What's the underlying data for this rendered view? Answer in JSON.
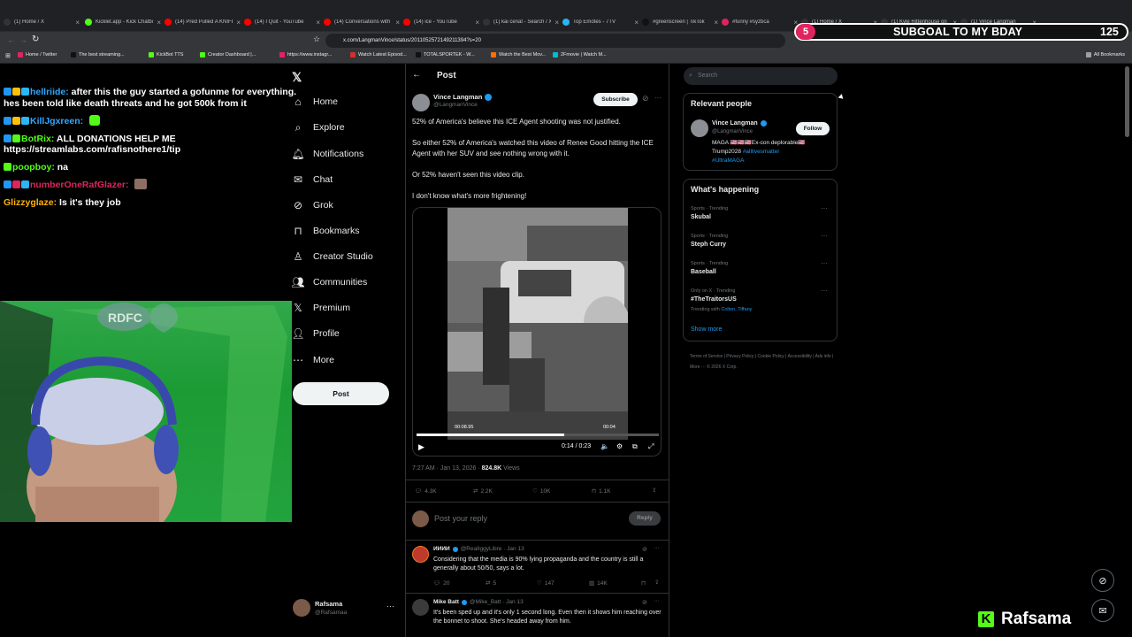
{
  "browser": {
    "tabs": [
      {
        "label": "(1) Home / X",
        "color": "#333"
      },
      {
        "label": "Kicklet.app - Kick Chatbot",
        "color": "#53fc18"
      },
      {
        "label": "(14) Pred Pulled A KNIFE",
        "color": "#ff0000"
      },
      {
        "label": "(14) I Quit - YouTube",
        "color": "#ff0000"
      },
      {
        "label": "(14) Conversations with",
        "color": "#ff0000"
      },
      {
        "label": "(14) ice - YouTube",
        "color": "#ff0000"
      },
      {
        "label": "(1) kai cenat - Search / X",
        "color": "#333"
      },
      {
        "label": "Top Emotes - 7TV",
        "color": "#29b6f6"
      },
      {
        "label": "#greenscreen | TikTok",
        "color": "#111"
      },
      {
        "label": "#funny #syzbca",
        "color": "#e0245e"
      },
      {
        "label": "(1) Home / X",
        "color": "#333"
      },
      {
        "label": "(1) Kyle Rittenhouse on",
        "color": "#333"
      },
      {
        "label": "(1) Vince Langman",
        "color": "#333"
      }
    ],
    "url": "x.com/LangmanVince/status/2011052572149211394?s=20",
    "bookmarks": [
      "Home / Twitter",
      "The best streaming...",
      "KickBot TTS",
      "Creator Dashboard |...",
      "https://www.instagr...",
      "Watch Latest Episod...",
      "TOTALSPORTEK - W...",
      "Watch the Best Mov...",
      "2Fmovie | Watch M..."
    ],
    "all_bookmarks": "All Bookmarks"
  },
  "overlay": {
    "subgoal_badge": "5",
    "subgoal_text": "SUBGOAL TO MY BDAY",
    "subgoal_count": "125",
    "streamer": "Rafsama"
  },
  "chat": [
    {
      "user": "hellriide:",
      "userColor": "#2ea8ff",
      "msg": " after this the guy started a gofunme for everything. hes been told like death threats and he got 500k from it",
      "badges": [
        "#2196f3",
        "#ffc107",
        "#29b6f6"
      ]
    },
    {
      "user": "KillJgxreen:",
      "userColor": "#2ea8ff",
      "msg": " ",
      "badges": [
        "#2196f3",
        "#ffc107",
        "#29b6f6"
      ],
      "emote": true
    },
    {
      "user": "BotRix:",
      "userColor": "#53fc18",
      "msg": " ALL DONATIONS HELP ME https://streamlabs.com/rafisnothere1/tip",
      "badges": [
        "#2196f3",
        "#53fc18"
      ]
    },
    {
      "user": "poopboy:",
      "userColor": "#53fc18",
      "msg": " na",
      "badges": [
        "#53fc18"
      ]
    },
    {
      "user": "numberOneRafGlazer:",
      "userColor": "#e0245e",
      "msg": " ",
      "badges": [
        "#2196f3",
        "#e0245e",
        "#29b6f6"
      ],
      "emote2": true
    },
    {
      "user": "Glizzyglaze:",
      "userColor": "#ffb300",
      "msg": " Is it's they job",
      "badges": []
    }
  ],
  "nav": {
    "items": [
      "Home",
      "Explore",
      "Notifications",
      "Chat",
      "Grok",
      "Bookmarks",
      "Creator Studio",
      "Communities",
      "Premium",
      "Profile",
      "More"
    ],
    "post": "Post",
    "account_name": "Rafsama",
    "account_handle": "@Rafsamaa"
  },
  "post": {
    "header": "Post",
    "author": "Vince Langman",
    "handle": "@LangmanVince",
    "subscribe": "Subscribe",
    "p1": "52% of America's believe this ICE Agent shooting was not justified.",
    "p2": "So either 52% of America's watched this video of Renee Good hitting the ICE Agent with her SUV and see nothing wrong with it.",
    "p3": "Or 52% haven't seen this video clip.",
    "p4": "I don't know what's more frightening!",
    "video_time_left": "00:08.95",
    "video_time_right": "00:04",
    "video_progress": "0:14 / 0:23",
    "progress_fraction": 0.61,
    "timestamp": "7:27 AM · Jan 13, 2026 · ",
    "views": "824.8K",
    "views_label": " Views",
    "replies": "4.3K",
    "reposts": "2.2K",
    "likes": "10K",
    "bookmarks": "1.1K",
    "reply_placeholder": "Post your reply",
    "reply_btn": "Reply"
  },
  "replies": [
    {
      "name": "ИИИИ",
      "handle": "@RealIggyLibre · Jan 13",
      "text": "Considering that the media is 90% lying propaganda and the country is still a generally about 50/50, says a lot.",
      "replies": "20",
      "reposts": "5",
      "likes": "147",
      "views": "14K"
    },
    {
      "name": "Mike Batt",
      "handle": "@Mike_Batt · Jan 13",
      "text": "It's been sped up and it's only 1 second long. Even then it shows him reaching over the bonnet to shoot. She's headed away from him."
    }
  ],
  "right": {
    "search_placeholder": "Search",
    "relevant_title": "Relevant people",
    "rp_name": "Vince Langman",
    "rp_handle": "@LangmanVince",
    "rp_follow": "Follow",
    "rp_bio1": "MAGA 🇺🇸🇺🇸🇺🇸Ex-con deplorable🇺🇸",
    "rp_bio2": "Trump2028 ",
    "rp_bio_tag1": "#alllivesmatter",
    "rp_bio_tag2": "#UltraMAGA",
    "happening_title": "What's happening",
    "trends": [
      {
        "cat": "Sports · Trending",
        "name": "Skubal"
      },
      {
        "cat": "Sports · Trending",
        "name": "Steph Curry"
      },
      {
        "cat": "Sports · Trending",
        "name": "Baseball"
      },
      {
        "cat": "Only on X · Trending",
        "name": "#TheTraitorsUS"
      }
    ],
    "trend_with": "Trending with ",
    "trend_with_names": "Colton, Tiffany",
    "show_more": "Show more",
    "footer": "Terms of Service  |  Privacy Policy  |  Cookie Policy  |  Accessibility  |  Ads info  |  More ···  © 2026 X Corp."
  }
}
